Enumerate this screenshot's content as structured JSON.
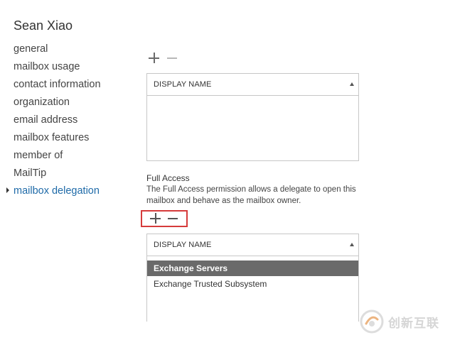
{
  "page": {
    "title": "Sean Xiao"
  },
  "nav": {
    "items": [
      {
        "label": "general"
      },
      {
        "label": "mailbox usage"
      },
      {
        "label": "contact information"
      },
      {
        "label": "organization"
      },
      {
        "label": "email address"
      },
      {
        "label": "mailbox features"
      },
      {
        "label": "member of"
      },
      {
        "label": "MailTip"
      },
      {
        "label": "mailbox delegation",
        "active": true
      }
    ]
  },
  "send_as": {
    "grid": {
      "header": "DISPLAY NAME",
      "rows": []
    }
  },
  "full_access": {
    "label": "Full Access",
    "description": "The Full Access permission allows a delegate to open this mailbox and behave as the mailbox owner.",
    "grid": {
      "header": "DISPLAY NAME",
      "rows": [
        {
          "name": "Exchange Servers",
          "selected": true
        },
        {
          "name": "Exchange Trusted Subsystem",
          "selected": false
        }
      ]
    }
  },
  "watermark": {
    "text": "创新互联"
  },
  "colors": {
    "accent": "#1e6aa8",
    "selected_row": "#6a6a6a",
    "highlight_box": "#d63b3b"
  }
}
